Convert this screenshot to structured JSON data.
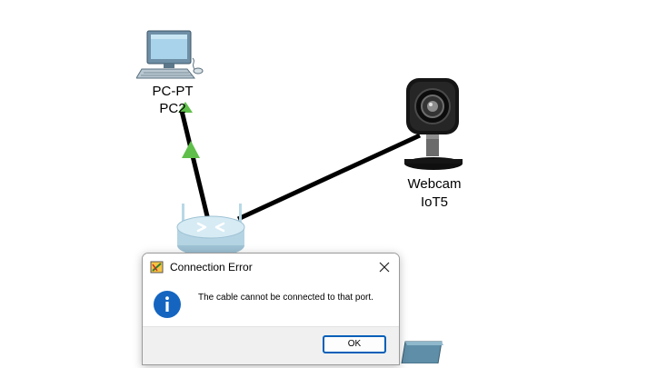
{
  "workspace": {
    "devices": [
      {
        "type_label": "PC-PT",
        "name": "PC2",
        "icon": "pc-icon"
      },
      {
        "type_label": "Webcam",
        "name": "IoT5",
        "icon": "webcam-icon"
      },
      {
        "type_label": "",
        "name": "",
        "icon": "router-icon"
      },
      {
        "type_label": "",
        "name": "",
        "icon": "device-icon"
      }
    ],
    "links": [
      {
        "from": "PC2",
        "to": "router",
        "status": "up"
      },
      {
        "from": "IoT5",
        "to": "router",
        "status": "none"
      }
    ],
    "colors": {
      "link": "#000000",
      "status_up": "#5fbf4a"
    }
  },
  "dialog": {
    "title": "Connection Error",
    "message": "The cable cannot be connected to that port.",
    "icon": "info-icon",
    "ok_label": "OK",
    "colors": {
      "info_icon": "#1565c0",
      "button_border": "#005fb8"
    }
  }
}
